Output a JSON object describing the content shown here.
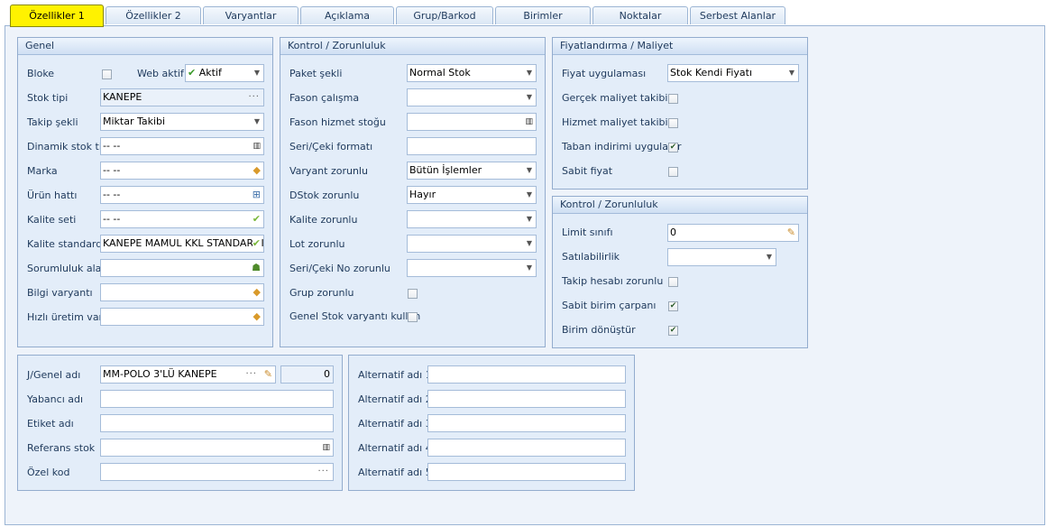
{
  "tabs": [
    "Özellikler 1",
    "Özellikler 2",
    "Varyantlar",
    "Açıklama",
    "Grup/Barkod",
    "Birimler",
    "Noktalar",
    "Serbest Alanlar"
  ],
  "genel": {
    "title": "Genel",
    "bloke_label": "Bloke",
    "bloke_checked": false,
    "web_aktif_label": "Web aktif",
    "web_aktif_value": "Aktif",
    "stok_tipi_label": "Stok tipi",
    "stok_tipi_value": "KANEPE",
    "takip_sekli_label": "Takip şekli",
    "takip_sekli_value": "Miktar Takibi",
    "dinamik_stok_tipi_label": "Dinamik stok tipi",
    "dinamik_stok_tipi_value": "-- --",
    "marka_label": "Marka",
    "marka_value": "-- --",
    "urun_hatti_label": "Ürün hattı",
    "urun_hatti_value": "-- --",
    "kalite_seti_label": "Kalite seti",
    "kalite_seti_value": "-- --",
    "kalite_standardi_label": "Kalite standardı",
    "kalite_standardi_value": "KANEPE MAMUL KKL STANDARDI",
    "sorumluluk_alani_label": "Sorumluluk alanı",
    "sorumluluk_alani_value": "",
    "bilgi_varyanti_label": "Bilgi varyantı",
    "bilgi_varyanti_value": "",
    "hizli_uretim_label": "Hızlı üretim vary",
    "hizli_uretim_value": ""
  },
  "kontrol": {
    "title": "Kontrol / Zorunluluk",
    "paket_sekli_label": "Paket şekli",
    "paket_sekli_value": "Normal Stok",
    "fason_calisma_label": "Fason çalışma",
    "fason_calisma_value": "",
    "fason_hizmet_label": "Fason hizmet stoğu",
    "fason_hizmet_value": "",
    "seri_format_label": "Seri/Çeki formatı",
    "seri_format_value": "",
    "varyant_zorunlu_label": "Varyant zorunlu",
    "varyant_zorunlu_value": "Bütün İşlemler",
    "dstok_zorunlu_label": "DStok zorunlu",
    "dstok_zorunlu_value": "Hayır",
    "kalite_zorunlu_label": "Kalite zorunlu",
    "kalite_zorunlu_value": "",
    "lot_zorunlu_label": "Lot zorunlu",
    "lot_zorunlu_value": "",
    "seri_no_zorunlu_label": "Seri/Çeki No zorunlu",
    "seri_no_zorunlu_value": "",
    "grup_zorunlu_label": "Grup zorunlu",
    "grup_zorunlu_checked": false,
    "genel_stok_varyanti_label": "Genel Stok varyantı kullan",
    "genel_stok_varyanti_checked": false
  },
  "fiyat": {
    "title": "Fiyatlandırma / Maliyet",
    "fiyat_uygulamasi_label": "Fiyat uygulaması",
    "fiyat_uygulamasi_value": "Stok Kendi Fiyatı",
    "gercek_maliyet_label": "Gerçek maliyet takibi",
    "gercek_maliyet_checked": false,
    "hizmet_maliyet_label": "Hizmet maliyet takibi",
    "hizmet_maliyet_checked": false,
    "taban_indirimi_label": "Taban indirimi uygulanır",
    "taban_indirimi_checked": true,
    "sabit_fiyat_label": "Sabit fiyat",
    "sabit_fiyat_checked": false
  },
  "kontrol2": {
    "title": "Kontrol / Zorunluluk",
    "limit_sinifi_label": "Limit sınıfı",
    "limit_sinifi_value": "0",
    "satilabilirlik_label": "Satılabilirlik",
    "satilabilirlik_value": "",
    "takip_hesabi_label": "Takip hesabı zorunlu",
    "takip_hesabi_checked": false,
    "sabit_birim_label": "Sabit birim çarpanı",
    "sabit_birim_checked": true,
    "birim_donustur_label": "Birim dönüştür",
    "birim_donustur_checked": true
  },
  "adlar": {
    "genel_adi_label": "J/Genel adı",
    "genel_adi_value": "MM-POLO 3'LÜ KANEPE",
    "genel_adi_count": "0",
    "yabanci_adi_label": "Yabancı adı",
    "yabanci_adi_value": "",
    "etiket_adi_label": "Etiket adı",
    "etiket_adi_value": "",
    "referans_stok_label": "Referans stok",
    "referans_stok_value": "",
    "ozel_kod_label": "Özel kod",
    "ozel_kod_value": ""
  },
  "alternatif": {
    "labels": [
      "Alternatif adı 1",
      "Alternatif adı 2",
      "Alternatif adı 3",
      "Alternatif adı 4",
      "Alternatif adı 5"
    ],
    "values": [
      "",
      "",
      "",
      "",
      ""
    ]
  },
  "icons": {
    "dropdown": "chevron-down-icon",
    "ellipsis": "ellipsis-icon",
    "barcode": "barcode-icon",
    "eraser": "eraser-icon",
    "tree": "tree-icon",
    "check": "green-check-icon",
    "people": "people-icon",
    "edit": "edit-icon"
  },
  "colors": {
    "active_tab": "#fff200",
    "panel_bg": "#e3edf9",
    "panel_border": "#93acce",
    "label": "#1e395b"
  }
}
